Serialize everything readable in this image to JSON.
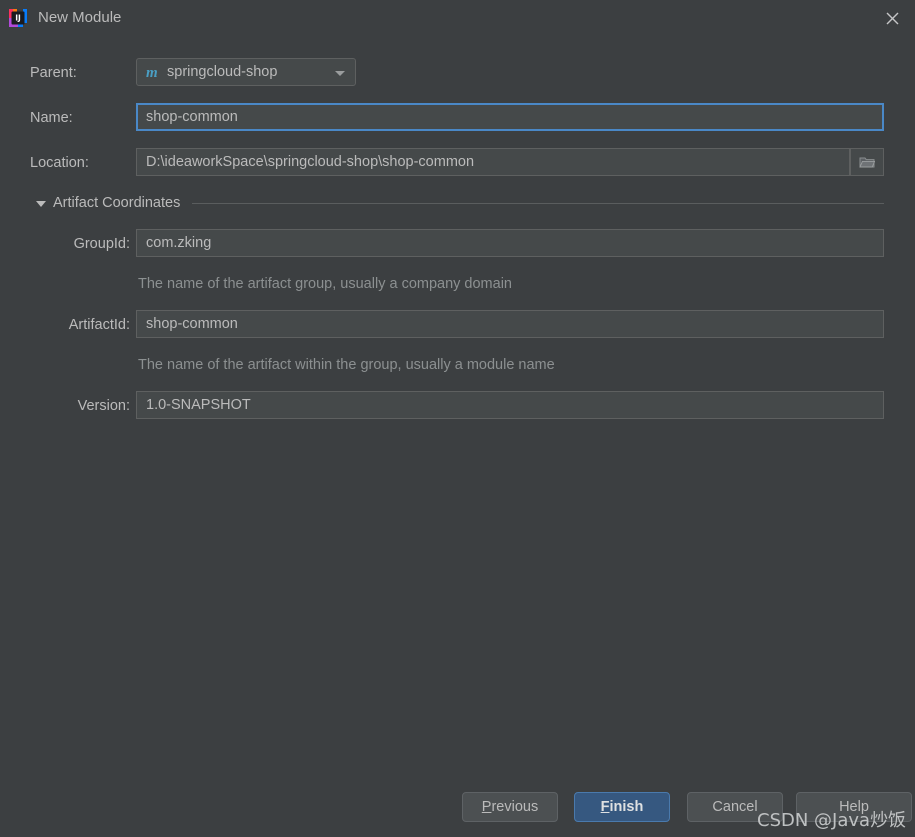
{
  "window": {
    "title": "New Module",
    "app_icon": "intellij-idea-icon",
    "close_icon": "close-icon"
  },
  "form": {
    "parent": {
      "label": "Parent:",
      "value": "springcloud-shop",
      "icon": "maven-module-icon",
      "icon_glyph": "m",
      "dropdown_icon": "chevron-down-icon"
    },
    "name": {
      "label": "Name:",
      "value": "shop-common"
    },
    "location": {
      "label": "Location:",
      "value": "D:\\ideaworkSpace\\springcloud-shop\\shop-common",
      "browse_icon": "folder-icon"
    },
    "artifact_section": {
      "label": "Artifact Coordinates",
      "expand_icon": "triangle-down-icon",
      "expanded": true
    },
    "group_id": {
      "label": "GroupId:",
      "value": "com.zking",
      "hint": "The name of the artifact group, usually a company domain"
    },
    "artifact_id": {
      "label": "ArtifactId:",
      "value": "shop-common",
      "hint": "The name of the artifact within the group, usually a module name"
    },
    "version": {
      "label": "Version:",
      "value": "1.0-SNAPSHOT"
    }
  },
  "buttons": {
    "previous": {
      "mnemonic": "P",
      "rest": "revious"
    },
    "finish": {
      "mnemonic": "F",
      "rest": "inish"
    },
    "cancel": {
      "label": "Cancel"
    },
    "help": {
      "label": "Help"
    }
  },
  "watermark": {
    "text": "CSDN @Java炒饭"
  },
  "colors": {
    "background": "#3c3f41",
    "field_background": "#45494a",
    "focus_border": "#4a88c7",
    "primary_button": "#365880",
    "text": "#bbbbbb",
    "hint_text": "#8c9091",
    "maven_icon": "#4a9fc4"
  }
}
